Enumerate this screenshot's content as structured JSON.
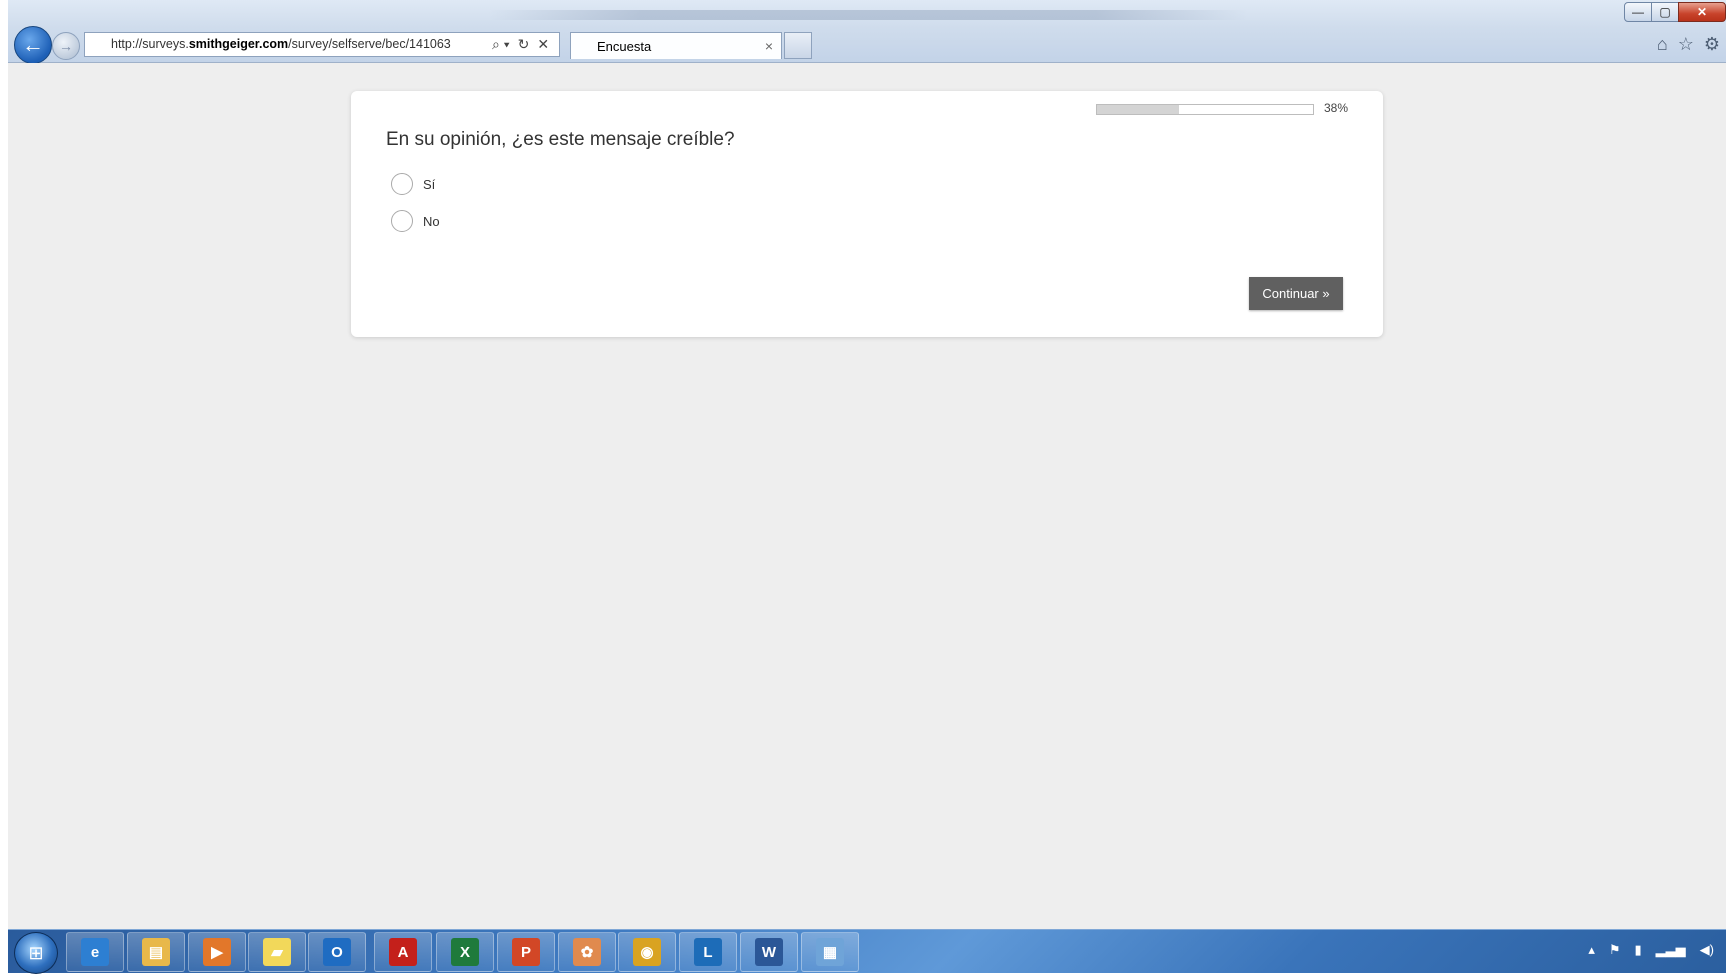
{
  "browser": {
    "url_prefix": "http://surveys.",
    "url_domain": "smithgeiger.com",
    "url_path": "/survey/selfserve/bec/141063",
    "tab_title": "Encuesta",
    "tab_close_glyph": "×",
    "back_glyph": "←",
    "forward_glyph": "→",
    "search_glyph": "⌕ ▾",
    "refresh_glyph": "↻",
    "stop_glyph": "✕",
    "home_glyph": "⌂",
    "favorites_glyph": "☆",
    "tools_glyph": "⚙",
    "minimize_glyph": "—",
    "maximize_glyph": "▢",
    "close_glyph": "✕"
  },
  "survey": {
    "progress_percent": 38,
    "progress_label": "38%",
    "question": "En su opinión, ¿es este mensaje creíble?",
    "options": [
      "Sí",
      "No"
    ],
    "continue_label": "Continuar »"
  },
  "taskbar": {
    "apps": [
      {
        "name": "internet-explorer",
        "glyph": "e",
        "color": "#2d7fd2"
      },
      {
        "name": "file-explorer",
        "glyph": "▤",
        "color": "#e8b84a"
      },
      {
        "name": "media-player",
        "glyph": "▶",
        "color": "#e2772a"
      },
      {
        "name": "sticky-notes",
        "glyph": "▰",
        "color": "#f2d85a"
      },
      {
        "name": "outlook",
        "glyph": "O",
        "color": "#1f6cc2"
      },
      {
        "name": "acrobat",
        "glyph": "A",
        "color": "#c4201b"
      },
      {
        "name": "excel",
        "glyph": "X",
        "color": "#1f7a3c"
      },
      {
        "name": "powerpoint",
        "glyph": "P",
        "color": "#d24726"
      },
      {
        "name": "app-orange",
        "glyph": "✿",
        "color": "#e08a4e"
      },
      {
        "name": "chrome",
        "glyph": "◉",
        "color": "#d9a321"
      },
      {
        "name": "lync",
        "glyph": "L",
        "color": "#1d6cb8"
      },
      {
        "name": "word",
        "glyph": "W",
        "color": "#2b5797"
      },
      {
        "name": "remote-desktop",
        "glyph": "▦",
        "color": "#6fa4d8"
      }
    ],
    "tray": [
      "▴",
      "⚑",
      "▮",
      "▂▃▅",
      "◀)"
    ]
  }
}
